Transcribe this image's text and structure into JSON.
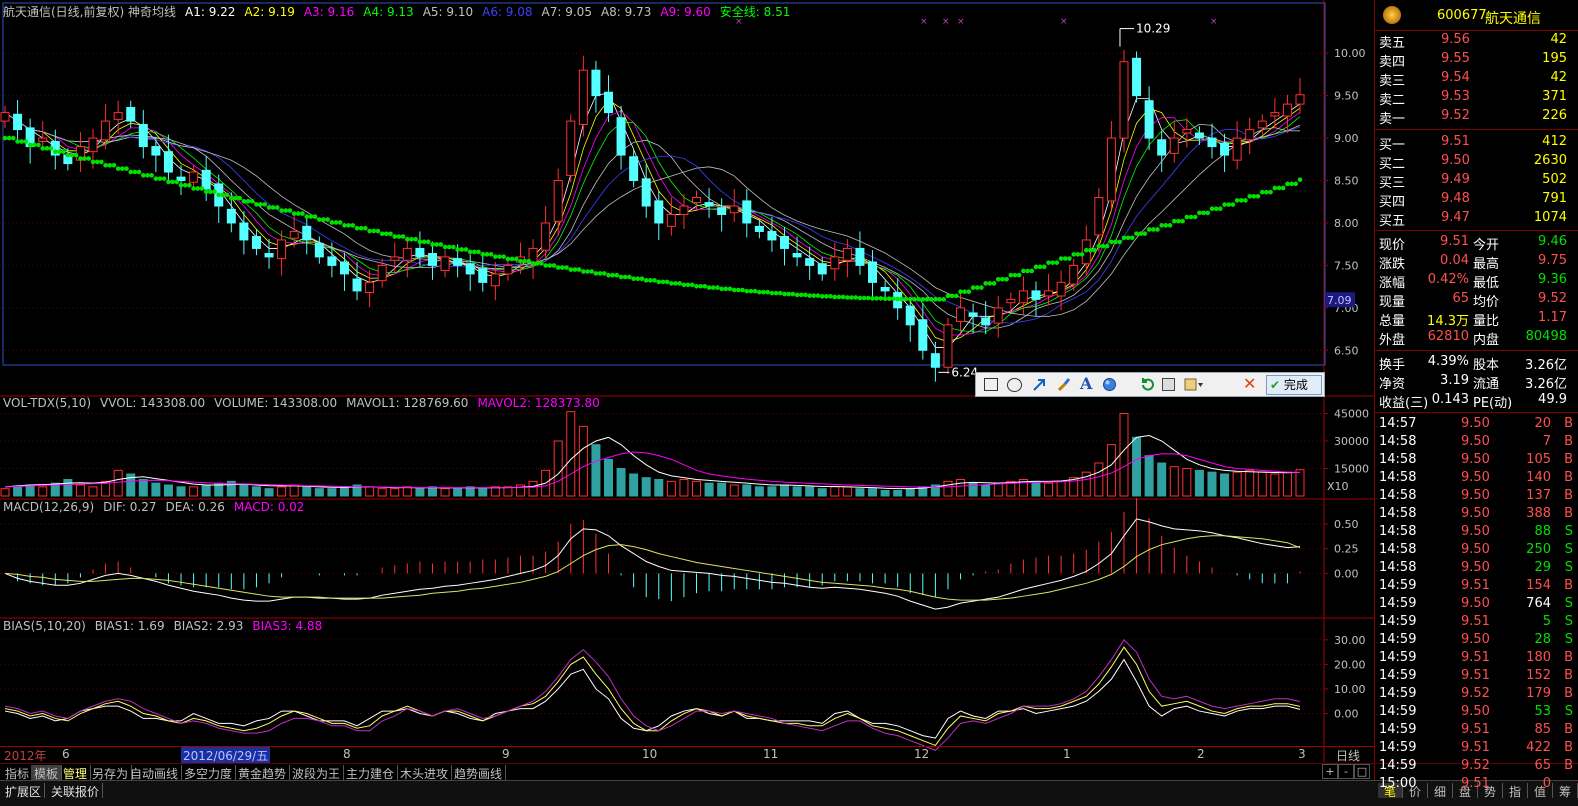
{
  "title": "航天通信(日线,前复权) 神奇均线",
  "ma_labels": [
    {
      "text": "A1: 9.22",
      "color": "#ffffff"
    },
    {
      "text": "A2: 9.19",
      "color": "#ffff00"
    },
    {
      "text": "A3: 9.16",
      "color": "#ff00ff"
    },
    {
      "text": "A4: 9.13",
      "color": "#00ff00"
    },
    {
      "text": "A5: 9.10",
      "color": "#c0c0c0"
    },
    {
      "text": "A6: 9.08",
      "color": "#4040ff"
    },
    {
      "text": "A7: 9.05",
      "color": "#c0c0c0"
    },
    {
      "text": "A8: 9.73",
      "color": "#c0c0c0"
    },
    {
      "text": "A9: 9.60",
      "color": "#ff00ff"
    },
    {
      "text": "安全线: 8.51",
      "color": "#00ff00"
    }
  ],
  "high_label": "10.29",
  "low_label": "6.24",
  "price_marker": "7.09",
  "vol_header": [
    {
      "text": "VOL-TDX(5,10)",
      "color": "#c0c0c0"
    },
    {
      "text": "VVOL: 143308.00",
      "color": "#c0c0c0"
    },
    {
      "text": "VOLUME: 143308.00",
      "color": "#c0c0c0"
    },
    {
      "text": "MAVOL1: 128769.60",
      "color": "#c0c0c0"
    },
    {
      "text": "MAVOL2: 128373.80",
      "color": "#ff00ff"
    }
  ],
  "vol_unit": "X10",
  "macd_header": [
    {
      "text": "MACD(12,26,9)",
      "color": "#c0c0c0"
    },
    {
      "text": "DIF: 0.27",
      "color": "#c0c0c0"
    },
    {
      "text": "DEA: 0.26",
      "color": "#c0c0c0"
    },
    {
      "text": "MACD: 0.02",
      "color": "#ff00ff"
    }
  ],
  "bias_header": [
    {
      "text": "BIAS(5,10,20)",
      "color": "#c0c0c0"
    },
    {
      "text": "BIAS1: 1.69",
      "color": "#c0c0c0"
    },
    {
      "text": "BIAS2: 2.93",
      "color": "#c0c0c0"
    },
    {
      "text": "BIAS3: 4.88",
      "color": "#ff00ff"
    }
  ],
  "date_axis": {
    "year": "2012年",
    "marker": "2012/06/29/五",
    "months": [
      "6",
      "8",
      "9",
      "10",
      "11",
      "12",
      "1",
      "2",
      "3"
    ],
    "period": "日线"
  },
  "tabs": [
    "指标",
    "模板",
    "管理",
    "另存为",
    "自动画线",
    "多空力度",
    "黄金趋势",
    "波段为王",
    "主力建仓",
    "木头进攻",
    "趋势画线"
  ],
  "bottom_tabs": [
    "扩展区",
    "关联报价"
  ],
  "right_bottom_tabs": [
    "笔",
    "价",
    "细",
    "盘",
    "势",
    "指",
    "值",
    "筹"
  ],
  "zoom_controls": [
    "+",
    "-",
    "□"
  ],
  "draw_toolbar": {
    "done_label": "完成"
  },
  "stock": {
    "code": "600677",
    "name": "航天通信"
  },
  "sells": [
    {
      "label": "卖五",
      "price": "9.56",
      "vol": "42"
    },
    {
      "label": "卖四",
      "price": "9.55",
      "vol": "195"
    },
    {
      "label": "卖三",
      "price": "9.54",
      "vol": "42"
    },
    {
      "label": "卖二",
      "price": "9.53",
      "vol": "371"
    },
    {
      "label": "卖一",
      "price": "9.52",
      "vol": "226"
    }
  ],
  "buys": [
    {
      "label": "买一",
      "price": "9.51",
      "vol": "412"
    },
    {
      "label": "买二",
      "price": "9.50",
      "vol": "2630"
    },
    {
      "label": "买三",
      "price": "9.49",
      "vol": "502"
    },
    {
      "label": "买四",
      "price": "9.48",
      "vol": "791"
    },
    {
      "label": "买五",
      "price": "9.47",
      "vol": "1074"
    }
  ],
  "stats": [
    {
      "l1": "现价",
      "v1": "9.51",
      "c1": "red",
      "l2": "今开",
      "v2": "9.46",
      "c2": "green"
    },
    {
      "l1": "涨跌",
      "v1": "0.04",
      "c1": "red",
      "l2": "最高",
      "v2": "9.75",
      "c2": "red"
    },
    {
      "l1": "涨幅",
      "v1": "0.42%",
      "c1": "red",
      "l2": "最低",
      "v2": "9.36",
      "c2": "green"
    },
    {
      "l1": "现量",
      "v1": "65",
      "c1": "red",
      "l2": "均价",
      "v2": "9.52",
      "c2": "red"
    },
    {
      "l1": "总量",
      "v1": "14.3万",
      "c1": "yellow",
      "l2": "量比",
      "v2": "1.17",
      "c2": "red"
    },
    {
      "l1": "外盘",
      "v1": "62810",
      "c1": "red",
      "l2": "内盘",
      "v2": "80498",
      "c2": "green"
    }
  ],
  "fund": [
    {
      "l1": "换手",
      "v1": "4.39%",
      "l2": "股本",
      "v2": "3.26亿"
    },
    {
      "l1": "净资",
      "v1": "3.19",
      "l2": "流通",
      "v2": "3.26亿"
    },
    {
      "l1": "收益(三)",
      "v1": "0.143",
      "l2": "PE(动)",
      "v2": "49.9"
    }
  ],
  "ticks": [
    [
      "14:57",
      "9.50",
      "20",
      "B"
    ],
    [
      "14:58",
      "9.50",
      "7",
      "B"
    ],
    [
      "14:58",
      "9.50",
      "105",
      "B"
    ],
    [
      "14:58",
      "9.50",
      "140",
      "B"
    ],
    [
      "14:58",
      "9.50",
      "137",
      "B"
    ],
    [
      "14:58",
      "9.50",
      "388",
      "B"
    ],
    [
      "14:58",
      "9.50",
      "88",
      "S"
    ],
    [
      "14:58",
      "9.50",
      "250",
      "S"
    ],
    [
      "14:58",
      "9.50",
      "29",
      "S"
    ],
    [
      "14:59",
      "9.51",
      "154",
      "B"
    ],
    [
      "14:59",
      "9.50",
      "764",
      "S"
    ],
    [
      "14:59",
      "9.51",
      "5",
      "S"
    ],
    [
      "14:59",
      "9.50",
      "28",
      "S"
    ],
    [
      "14:59",
      "9.51",
      "180",
      "B"
    ],
    [
      "14:59",
      "9.51",
      "152",
      "B"
    ],
    [
      "14:59",
      "9.52",
      "179",
      "B"
    ],
    [
      "14:59",
      "9.50",
      "53",
      "S"
    ],
    [
      "14:59",
      "9.51",
      "85",
      "B"
    ],
    [
      "14:59",
      "9.51",
      "422",
      "B"
    ],
    [
      "14:59",
      "9.52",
      "65",
      "B"
    ],
    [
      "15:00",
      "9.51",
      "0",
      ""
    ]
  ],
  "chart_data": [
    {
      "type": "candlestick",
      "panel": "price",
      "y_ticks": [
        10.0,
        9.5,
        9.0,
        8.5,
        8.0,
        7.5,
        7.0,
        6.5
      ],
      "ylim": [
        6.15,
        10.45
      ],
      "close_series": [
        9.3,
        9.1,
        8.9,
        9.0,
        8.8,
        8.7,
        8.9,
        9.0,
        9.2,
        9.3,
        9.2,
        8.9,
        8.8,
        8.6,
        8.5,
        8.6,
        8.4,
        8.2,
        8.0,
        7.8,
        7.7,
        7.6,
        7.8,
        7.9,
        7.8,
        7.6,
        7.5,
        7.4,
        7.2,
        7.3,
        7.5,
        7.6,
        7.7,
        7.6,
        7.5,
        7.6,
        7.5,
        7.4,
        7.3,
        7.4,
        7.5,
        7.6,
        7.7,
        8.0,
        8.5,
        9.2,
        9.8,
        9.5,
        9.3,
        8.8,
        8.5,
        8.2,
        8.0,
        8.1,
        8.2,
        8.3,
        8.2,
        8.1,
        8.2,
        8.0,
        7.9,
        7.8,
        7.7,
        7.6,
        7.5,
        7.4,
        7.6,
        7.7,
        7.5,
        7.3,
        7.2,
        7.0,
        6.8,
        6.5,
        6.3,
        6.8,
        7.0,
        6.9,
        6.8,
        7.0,
        7.1,
        7.2,
        7.1,
        7.2,
        7.3,
        7.5,
        7.8,
        8.3,
        9.0,
        9.9,
        9.5,
        9.0,
        8.8,
        9.0,
        9.1,
        9.0,
        8.9,
        8.8,
        9.0,
        9.1,
        9.2,
        9.3,
        9.4,
        9.51
      ],
      "safety_line_start": 9.0,
      "safety_line_min": 7.1,
      "safety_line_end": 8.51
    },
    {
      "type": "bar",
      "panel": "volume",
      "y_ticks": [
        45000,
        30000,
        15000
      ],
      "ylim": [
        0,
        48000
      ],
      "values": [
        4000,
        5000,
        6000,
        5000,
        7000,
        9000,
        6000,
        5000,
        8000,
        14000,
        12000,
        9000,
        7000,
        6000,
        5000,
        5000,
        6000,
        7000,
        8000,
        6000,
        5000,
        4000,
        5000,
        6000,
        5000,
        4000,
        4000,
        5000,
        6000,
        5000,
        4000,
        4000,
        5000,
        4000,
        5000,
        4000,
        4000,
        5000,
        4000,
        5000,
        5000,
        6000,
        8000,
        14000,
        30000,
        46000,
        38000,
        28000,
        20000,
        15000,
        12000,
        10000,
        9000,
        8000,
        9000,
        8000,
        7000,
        7000,
        6000,
        6000,
        5000,
        5000,
        6000,
        5000,
        5000,
        4000,
        5000,
        5000,
        4000,
        4000,
        3000,
        3000,
        4000,
        5000,
        6000,
        8000,
        9000,
        7000,
        6000,
        7000,
        8000,
        9000,
        8000,
        7000,
        8000,
        10000,
        13000,
        18000,
        28000,
        45000,
        32000,
        22000,
        18000,
        16000,
        15000,
        14000,
        13000,
        12000,
        13000,
        14000,
        13000,
        12000,
        13000,
        14330
      ],
      "mavol1": [
        5000,
        5500,
        6000,
        6200,
        6500,
        7000,
        7200,
        7000,
        7500,
        9000,
        10000,
        10500,
        9500,
        8500,
        7500,
        6500,
        6000,
        6000,
        6200,
        6400,
        6000,
        5600,
        5500,
        5500,
        5300,
        5000,
        4800,
        4800,
        5000,
        5000,
        4800,
        4600,
        4600,
        4500,
        4500,
        4400,
        4400,
        4500,
        4400,
        4500,
        4600,
        4800,
        5200,
        7000,
        12000,
        20000,
        26000,
        30000,
        32000,
        28000,
        22000,
        17000,
        13000,
        11000,
        10000,
        9000,
        8500,
        8000,
        7500,
        7000,
        6500,
        6000,
        6000,
        5800,
        5500,
        5200,
        5200,
        5000,
        4800,
        4600,
        4200,
        4000,
        4000,
        4300,
        5000,
        6000,
        7000,
        7400,
        7200,
        7000,
        7300,
        7800,
        8000,
        8000,
        8200,
        9000,
        10500,
        13000,
        17000,
        25000,
        32000,
        33000,
        30000,
        25000,
        20000,
        17000,
        15000,
        14000,
        13500,
        13200,
        13000,
        12800,
        12700,
        12877
      ],
      "mavol2": [
        5000,
        5200,
        5500,
        5800,
        6000,
        6300,
        6500,
        6700,
        6900,
        7500,
        8000,
        8500,
        8600,
        8400,
        8000,
        7600,
        7200,
        6900,
        6700,
        6600,
        6400,
        6200,
        6000,
        5800,
        5600,
        5500,
        5300,
        5200,
        5100,
        5000,
        4900,
        4800,
        4700,
        4650,
        4600,
        4550,
        4500,
        4500,
        4500,
        4500,
        4550,
        4600,
        4800,
        5500,
        8000,
        12000,
        16000,
        19000,
        21000,
        23000,
        24000,
        23500,
        22000,
        20000,
        17000,
        14000,
        12000,
        11000,
        10000,
        9200,
        8600,
        8000,
        7600,
        7200,
        6900,
        6600,
        6300,
        6000,
        5800,
        5600,
        5400,
        5200,
        5000,
        4900,
        4900,
        5000,
        5400,
        5800,
        6200,
        6600,
        6900,
        7200,
        7400,
        7600,
        7800,
        8200,
        9000,
        10500,
        12500,
        16000,
        20000,
        22000,
        23000,
        23000,
        22000,
        20000,
        18000,
        16000,
        15000,
        14500,
        14000,
        13500,
        13000,
        12837
      ]
    },
    {
      "type": "bar",
      "panel": "macd",
      "y_ticks": [
        0.5,
        0.25,
        0.0
      ],
      "ylim": [
        -0.42,
        0.62
      ],
      "dif": [
        0.0,
        -0.05,
        -0.08,
        -0.1,
        -0.12,
        -0.12,
        -0.1,
        -0.06,
        -0.02,
        0.0,
        -0.02,
        -0.05,
        -0.08,
        -0.12,
        -0.15,
        -0.18,
        -0.2,
        -0.22,
        -0.25,
        -0.27,
        -0.28,
        -0.28,
        -0.26,
        -0.24,
        -0.24,
        -0.25,
        -0.25,
        -0.26,
        -0.26,
        -0.25,
        -0.22,
        -0.2,
        -0.18,
        -0.16,
        -0.15,
        -0.13,
        -0.12,
        -0.1,
        -0.08,
        -0.06,
        -0.03,
        0.0,
        0.03,
        0.08,
        0.18,
        0.35,
        0.45,
        0.44,
        0.38,
        0.28,
        0.2,
        0.12,
        0.07,
        0.03,
        0.02,
        0.01,
        0.0,
        -0.02,
        -0.03,
        -0.05,
        -0.07,
        -0.09,
        -0.1,
        -0.12,
        -0.14,
        -0.15,
        -0.14,
        -0.15,
        -0.16,
        -0.18,
        -0.2,
        -0.23,
        -0.28,
        -0.32,
        -0.36,
        -0.34,
        -0.3,
        -0.28,
        -0.26,
        -0.24,
        -0.2,
        -0.16,
        -0.13,
        -0.1,
        -0.07,
        -0.03,
        0.02,
        0.1,
        0.2,
        0.38,
        0.55,
        0.52,
        0.48,
        0.45,
        0.44,
        0.43,
        0.41,
        0.38,
        0.36,
        0.33,
        0.3,
        0.28,
        0.26,
        0.27
      ],
      "dea": [
        0.0,
        -0.01,
        -0.03,
        -0.04,
        -0.06,
        -0.07,
        -0.08,
        -0.08,
        -0.07,
        -0.06,
        -0.05,
        -0.05,
        -0.06,
        -0.07,
        -0.09,
        -0.11,
        -0.13,
        -0.15,
        -0.17,
        -0.19,
        -0.21,
        -0.23,
        -0.24,
        -0.24,
        -0.24,
        -0.24,
        -0.25,
        -0.25,
        -0.25,
        -0.25,
        -0.25,
        -0.24,
        -0.23,
        -0.22,
        -0.2,
        -0.19,
        -0.18,
        -0.16,
        -0.15,
        -0.13,
        -0.11,
        -0.09,
        -0.06,
        -0.03,
        0.02,
        0.1,
        0.18,
        0.24,
        0.28,
        0.29,
        0.27,
        0.24,
        0.2,
        0.17,
        0.14,
        0.11,
        0.09,
        0.07,
        0.05,
        0.03,
        0.01,
        -0.01,
        -0.03,
        -0.05,
        -0.07,
        -0.09,
        -0.1,
        -0.11,
        -0.12,
        -0.13,
        -0.15,
        -0.16,
        -0.18,
        -0.21,
        -0.24,
        -0.26,
        -0.27,
        -0.27,
        -0.27,
        -0.26,
        -0.25,
        -0.23,
        -0.21,
        -0.19,
        -0.16,
        -0.13,
        -0.1,
        -0.06,
        -0.01,
        0.07,
        0.17,
        0.24,
        0.29,
        0.32,
        0.35,
        0.37,
        0.38,
        0.38,
        0.37,
        0.36,
        0.35,
        0.33,
        0.31,
        0.26
      ]
    },
    {
      "type": "line",
      "panel": "bias",
      "y_ticks": [
        30.0,
        20.0,
        10.0,
        0.0
      ],
      "ylim": [
        -12,
        34
      ],
      "bias1": [
        1,
        0,
        -2,
        -1,
        -3,
        -2,
        1,
        2,
        3,
        3,
        1,
        -2,
        -2,
        -3,
        -3,
        0,
        -2,
        -4,
        -4,
        -5,
        -3,
        -2,
        1,
        1,
        -1,
        -3,
        -3,
        -3,
        -5,
        -2,
        1,
        1,
        2,
        0,
        -1,
        1,
        0,
        -2,
        -3,
        0,
        1,
        2,
        2,
        5,
        10,
        16,
        18,
        10,
        6,
        -2,
        -6,
        -7,
        -5,
        -1,
        1,
        2,
        0,
        -1,
        1,
        -2,
        -2,
        -3,
        -3,
        -3,
        -3,
        -4,
        0,
        1,
        -2,
        -4,
        -4,
        -5,
        -7,
        -9,
        -10,
        -2,
        1,
        -1,
        -2,
        1,
        1,
        2,
        0,
        1,
        2,
        3,
        5,
        9,
        14,
        22,
        13,
        3,
        -1,
        2,
        3,
        1,
        0,
        -1,
        1,
        2,
        2,
        3,
        3,
        1.69
      ],
      "bias2": [
        2,
        1,
        -1,
        0,
        -2,
        -3,
        0,
        2,
        4,
        5,
        3,
        0,
        -1,
        -3,
        -4,
        -2,
        -3,
        -5,
        -6,
        -7,
        -6,
        -4,
        -1,
        1,
        0,
        -2,
        -4,
        -4,
        -6,
        -5,
        -1,
        1,
        3,
        1,
        -1,
        1,
        1,
        -1,
        -3,
        -1,
        1,
        3,
        4,
        7,
        13,
        20,
        23,
        16,
        10,
        2,
        -4,
        -7,
        -7,
        -3,
        0,
        2,
        1,
        -1,
        1,
        -1,
        -2,
        -3,
        -4,
        -4,
        -5,
        -5,
        -2,
        0,
        -2,
        -5,
        -6,
        -7,
        -9,
        -11,
        -13,
        -6,
        -1,
        -2,
        -3,
        0,
        1,
        3,
        2,
        2,
        3,
        5,
        7,
        12,
        19,
        27,
        20,
        9,
        3,
        4,
        5,
        3,
        1,
        0,
        2,
        3,
        3,
        4,
        4,
        2.93
      ],
      "bias3": [
        3,
        2,
        0,
        1,
        -1,
        -2,
        1,
        3,
        5,
        6,
        5,
        2,
        0,
        -2,
        -4,
        -3,
        -4,
        -6,
        -7,
        -8,
        -8,
        -7,
        -4,
        -2,
        -2,
        -3,
        -5,
        -5,
        -7,
        -7,
        -3,
        -1,
        2,
        1,
        -1,
        1,
        2,
        0,
        -2,
        -1,
        1,
        3,
        5,
        9,
        15,
        22,
        26,
        21,
        15,
        6,
        -1,
        -5,
        -7,
        -5,
        -2,
        1,
        1,
        0,
        1,
        0,
        -1,
        -2,
        -4,
        -5,
        -6,
        -7,
        -5,
        -3,
        -3,
        -6,
        -8,
        -9,
        -11,
        -13,
        -15,
        -10,
        -4,
        -3,
        -4,
        -2,
        0,
        3,
        3,
        3,
        4,
        6,
        9,
        15,
        22,
        30,
        25,
        14,
        7,
        6,
        7,
        5,
        3,
        2,
        3,
        4,
        5,
        6,
        6,
        4.88
      ]
    }
  ],
  "colors": {
    "up": "#ff3030",
    "down": "#54ffff",
    "frame": "#a00000",
    "grid": "#600000",
    "axis_text": "#c0c0c0",
    "safety": "#00e000"
  }
}
